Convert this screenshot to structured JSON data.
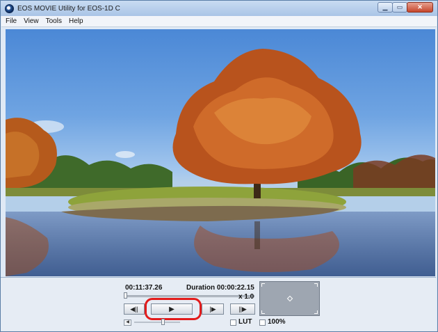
{
  "window": {
    "title": "EOS MOVIE Utility for EOS-1D C"
  },
  "menu": {
    "items": [
      "File",
      "View",
      "Tools",
      "Help"
    ]
  },
  "player": {
    "timecode": "00:11:37.26",
    "duration_label": "Duration 00:00:22.15",
    "speed": "x 1.0",
    "seek_progress": 0.0,
    "volume_level": 0.62,
    "play_symbol": "▶",
    "prev_symbol": "◀||",
    "next_symbol": "|▶",
    "last_symbol": "||▶"
  },
  "options": {
    "lut_label": "LUT",
    "lut_checked": false,
    "zoom_label": "100%",
    "zoom_checked": false
  },
  "icons": {
    "app": "eos-movie-app-icon",
    "volume": "speaker-icon",
    "play": "play-icon"
  },
  "colors": {
    "highlight": "#e21b1b",
    "titlebar": "#a9c4e6",
    "panel": "#e6ecf4"
  }
}
